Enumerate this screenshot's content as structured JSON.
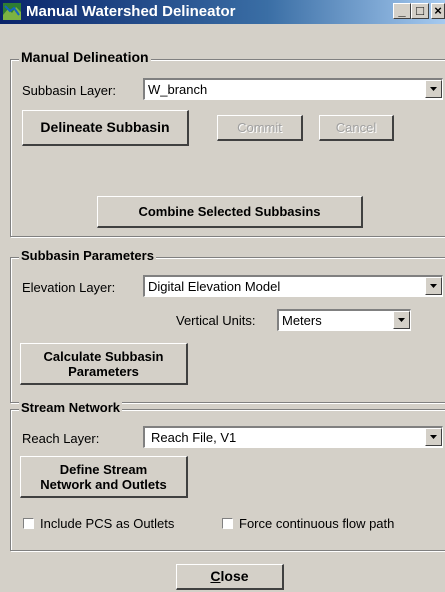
{
  "window": {
    "title": "Manual Watershed Delineator",
    "minimize_glyph": "_",
    "maximize_glyph": "□",
    "close_glyph": "×"
  },
  "manual_delineation": {
    "legend": "Manual Delineation",
    "subbasin_layer_label": "Subbasin Layer:",
    "subbasin_layer_value": "W_branch",
    "delineate_button": "Delineate Subbasin",
    "commit_button": "Commit",
    "cancel_button": "Cancel",
    "combine_button": "Combine Selected Subbasins"
  },
  "subbasin_parameters": {
    "legend": "Subbasin Parameters",
    "elevation_layer_label": "Elevation Layer:",
    "elevation_layer_value": "Digital Elevation Model",
    "vertical_units_label": "Vertical Units:",
    "vertical_units_value": "Meters",
    "calculate_button_line1": "Calculate Subbasin",
    "calculate_button_line2": "Parameters"
  },
  "stream_network": {
    "legend": "Stream Network",
    "reach_layer_label": "Reach Layer:",
    "reach_layer_value": "Reach File, V1",
    "define_button_line1": "Define Stream",
    "define_button_line2": "Network and Outlets",
    "include_pcs_label": "Include PCS as Outlets",
    "include_pcs_checked": false,
    "force_flow_label": "Force continuous flow path",
    "force_flow_checked": false
  },
  "footer": {
    "close_button": "Close"
  },
  "colors": {
    "titlebar_start": "#0a246a",
    "titlebar_end": "#a6caf0",
    "face": "#d4d0c8"
  }
}
